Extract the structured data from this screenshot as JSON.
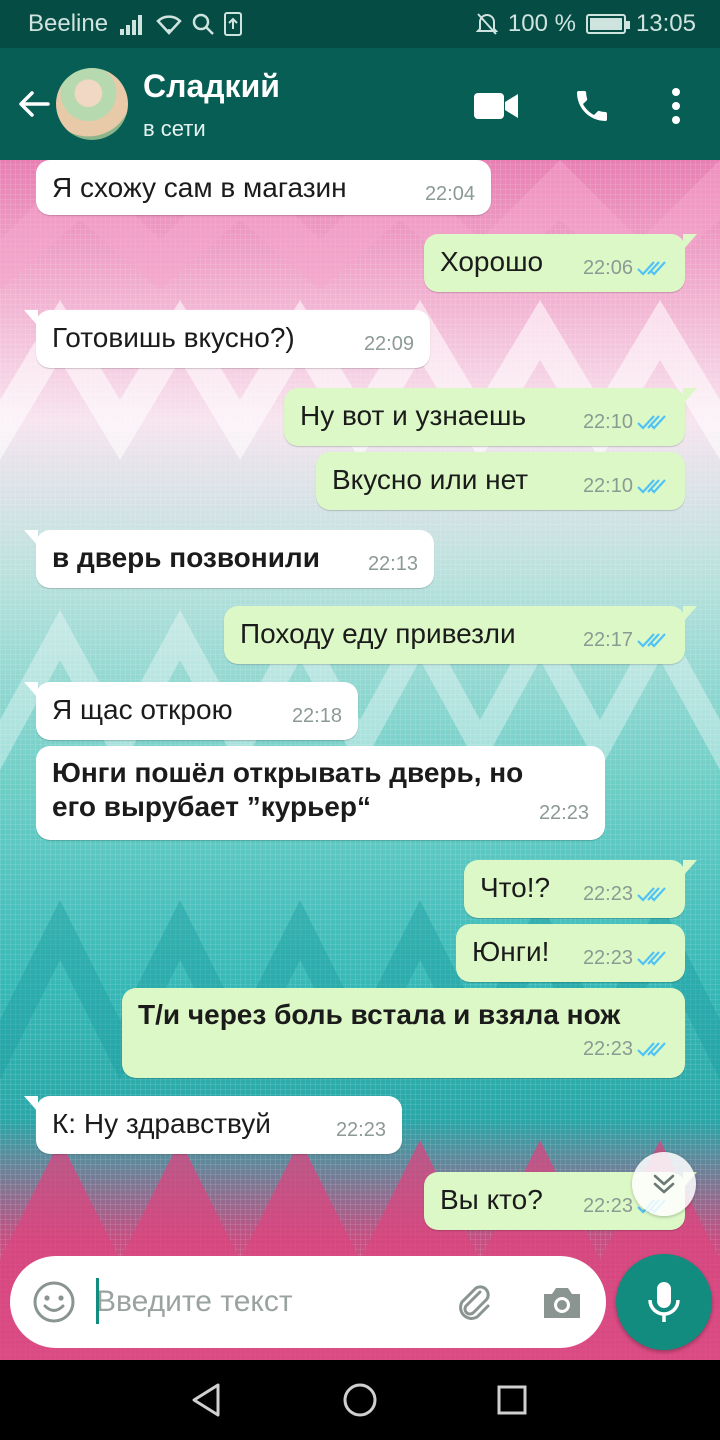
{
  "status_bar": {
    "carrier": "Beeline",
    "battery_percent": "100 %",
    "battery_level": 1.0,
    "time": "13:05",
    "icons": [
      "signal-icon",
      "wifi-icon",
      "search-icon",
      "upload-icon",
      "mute-bell-icon",
      "battery-icon"
    ]
  },
  "header": {
    "contact_name": "Сладкий",
    "contact_status": "в сети",
    "actions": [
      "video-call-icon",
      "phone-icon",
      "more-vert-icon"
    ]
  },
  "messages": [
    {
      "dir": "in",
      "text": "Я схожу сам в магазин",
      "time": "22:04",
      "bold": false
    },
    {
      "dir": "out",
      "text": "Хорошо",
      "time": "22:06",
      "bold": false,
      "read": true
    },
    {
      "dir": "in",
      "text": "Готовишь вкусно?)",
      "time": "22:09",
      "bold": false
    },
    {
      "dir": "out",
      "text": "Ну вот и узнаешь",
      "time": "22:10",
      "bold": false,
      "read": true
    },
    {
      "dir": "out",
      "text": "Вкусно или нет",
      "time": "22:10",
      "bold": false,
      "read": true
    },
    {
      "dir": "in",
      "text": "в дверь позвонили",
      "time": "22:13",
      "bold": true
    },
    {
      "dir": "out",
      "text": "Походу еду привезли",
      "time": "22:17",
      "bold": false,
      "read": true
    },
    {
      "dir": "in",
      "text": "Я щас открою",
      "time": "22:18",
      "bold": false
    },
    {
      "dir": "in",
      "text_line1": "Юнги пошёл открывать дверь, но",
      "text_line2": "его вырубает ”курьер“",
      "time": "22:23",
      "bold": true
    },
    {
      "dir": "out",
      "text": "Что!?",
      "time": "22:23",
      "bold": false,
      "read": true
    },
    {
      "dir": "out",
      "text": "Юнги!",
      "time": "22:23",
      "bold": false,
      "read": true
    },
    {
      "dir": "out",
      "text": "Т/и через боль встала и взяла нож",
      "time": "22:23",
      "bold": true,
      "read": true
    },
    {
      "dir": "in",
      "text": "К: Ну здравствуй",
      "time": "22:23",
      "bold": false
    },
    {
      "dir": "out",
      "text": "Вы кто?",
      "time": "22:23",
      "bold": false,
      "read": true
    }
  ],
  "composer": {
    "placeholder": "Введите текст",
    "icons": [
      "emoji-icon",
      "paperclip-icon",
      "camera-icon",
      "mic-icon"
    ]
  },
  "colors": {
    "header": "#075e54",
    "status_bar": "#054d44",
    "outgoing_bubble": "#dcf8c6",
    "incoming_bubble": "#ffffff",
    "read_ticks": "#4fc3f7",
    "accent": "#128c7e"
  }
}
